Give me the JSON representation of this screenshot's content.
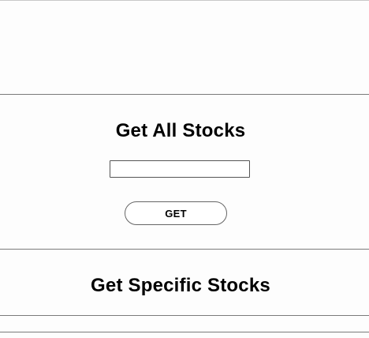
{
  "all_stocks": {
    "title": "Get All Stocks",
    "input_value": "",
    "input_placeholder": "",
    "button_label": "GET"
  },
  "specific_stocks": {
    "title": "Get Specific Stocks"
  }
}
